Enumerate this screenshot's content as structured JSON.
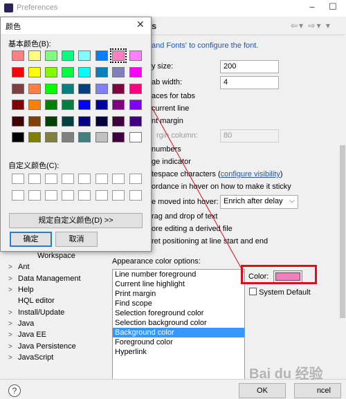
{
  "prefs": {
    "title": "Preferences",
    "page_heading": "rs",
    "font_hint": "and Fonts' to configure the font.",
    "fields": [
      {
        "label": "y size:",
        "value": "200"
      },
      {
        "label": "ab width:",
        "value": "4"
      }
    ],
    "options": [
      "aces for tabs",
      "current line",
      "nt margin"
    ],
    "margin_column": {
      "label": "rgin column:",
      "value": "80"
    },
    "more_options": [
      " numbers",
      "ge indicator"
    ],
    "whitespace": {
      "label": "tespace characters (",
      "link": "configure visibility",
      "suffix": ")"
    },
    "hover_text": "ordance in hover on how to make it sticky",
    "hover_moved": {
      "label": "e moved into hover:",
      "value": "Enrich after delay"
    },
    "more_text": [
      "rag and drop of text",
      "ore editing a derived file",
      "ret positioning at line start and end"
    ],
    "appearance_label": "Appearance color options:",
    "color_options": [
      "Line number foreground",
      "Current line highlight",
      "Print margin",
      "Find scope",
      "Selection foreground color",
      "Selection background color",
      "Background color",
      "Foreground color",
      "Hyperlink"
    ],
    "selected_index": 6,
    "color_label": "Color:",
    "system_default": "System Default",
    "ok": "OK",
    "cancel": "ncel",
    "help_icon": "?",
    "tree": [
      {
        "label": "Workspace",
        "twisty": "",
        "indent": 2
      },
      {
        "label": "Ant",
        "twisty": ">",
        "indent": 0
      },
      {
        "label": "Data Management",
        "twisty": ">",
        "indent": 0
      },
      {
        "label": "Help",
        "twisty": ">",
        "indent": 0
      },
      {
        "label": "HQL editor",
        "twisty": "",
        "indent": 0
      },
      {
        "label": "Install/Update",
        "twisty": ">",
        "indent": 0
      },
      {
        "label": "Java",
        "twisty": ">",
        "indent": 0
      },
      {
        "label": "Java EE",
        "twisty": ">",
        "indent": 0
      },
      {
        "label": "Java Persistence",
        "twisty": ">",
        "indent": 0
      },
      {
        "label": "JavaScript",
        "twisty": ">",
        "indent": 0
      }
    ],
    "selected_color": "#f47fc0"
  },
  "color_dialog": {
    "title": "颜色",
    "close": "✕",
    "basic_label": "基本颜色(B):",
    "custom_label": "自定义颜色(C):",
    "define_button": "规定自定义颜色(D) >>",
    "ok": "确定",
    "cancel": "取消",
    "selected_swatch": 5,
    "swatches": [
      [
        "#ff8080",
        "#ffff80",
        "#80ff80",
        "#00ff80",
        "#80ffff",
        "#0080ff",
        "#ff80c0",
        "#ff80ff"
      ],
      [
        "#ff0000",
        "#ffff00",
        "#80ff00",
        "#00ff40",
        "#00ffff",
        "#0080c0",
        "#8080c0",
        "#ff00ff"
      ],
      [
        "#804040",
        "#ff8040",
        "#00ff00",
        "#008080",
        "#004080",
        "#8080ff",
        "#800040",
        "#ff0080"
      ],
      [
        "#800000",
        "#ff8000",
        "#008000",
        "#008040",
        "#0000ff",
        "#0000a0",
        "#800080",
        "#8000ff"
      ],
      [
        "#400000",
        "#804000",
        "#004000",
        "#004040",
        "#000080",
        "#000040",
        "#400040",
        "#400080"
      ],
      [
        "#000000",
        "#808000",
        "#808040",
        "#808080",
        "#408080",
        "#c0c0c0",
        "#400040",
        "#ffffff"
      ]
    ]
  },
  "watermark": "Bai du 经验"
}
